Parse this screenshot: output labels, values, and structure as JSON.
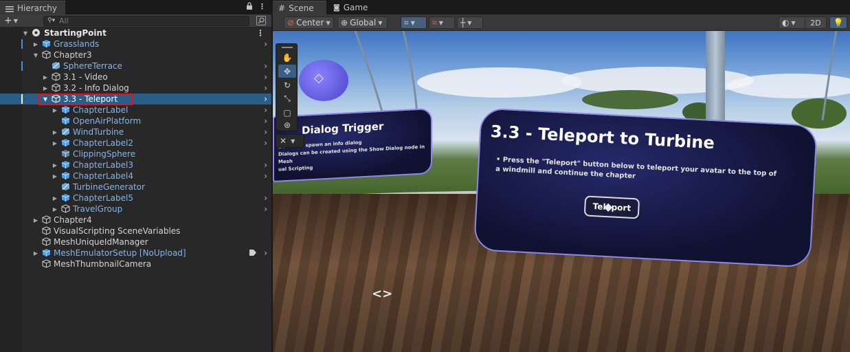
{
  "hierarchy": {
    "tab_label": "Hierarchy",
    "lock_icon": "lock-icon",
    "menu_icon": "vertical-ellipsis-icon",
    "add_label": "+",
    "search_placeholder": "All",
    "rows": [
      {
        "label": "StartingPoint",
        "kind": "root",
        "expanded": true
      },
      {
        "label": "Grasslands",
        "kind": "prefab",
        "expanded": false
      },
      {
        "label": "Chapter3",
        "kind": "plain",
        "expanded": true
      },
      {
        "label": "SphereTerrace",
        "kind": "prefab-variant"
      },
      {
        "label": "3.1 - Video",
        "kind": "plain",
        "expanded": false
      },
      {
        "label": "3.2 - Info Dialog",
        "kind": "plain",
        "expanded": false
      },
      {
        "label": "3.3 - Teleport",
        "kind": "plain",
        "expanded": true,
        "selected": true
      },
      {
        "label": "ChapterLabel",
        "kind": "prefab",
        "expanded": false
      },
      {
        "label": "OpenAirPlatform",
        "kind": "prefab"
      },
      {
        "label": "WindTurbine",
        "kind": "prefab-variant",
        "expanded": false
      },
      {
        "label": "ChapterLabel2",
        "kind": "prefab",
        "expanded": false
      },
      {
        "label": "ClippingSphere",
        "kind": "prefab"
      },
      {
        "label": "ChapterLabel3",
        "kind": "prefab",
        "expanded": false
      },
      {
        "label": "ChapterLabel4",
        "kind": "prefab",
        "expanded": false
      },
      {
        "label": "TurbineGenerator",
        "kind": "prefab"
      },
      {
        "label": "ChapterLabel5",
        "kind": "prefab",
        "expanded": false
      },
      {
        "label": "TravelGroup",
        "kind": "prefab",
        "expanded": false
      },
      {
        "label": "Chapter4",
        "kind": "plain",
        "expanded": false
      },
      {
        "label": "VisualScripting SceneVariables",
        "kind": "plain"
      },
      {
        "label": "MeshUniqueIdManager",
        "kind": "plain"
      },
      {
        "label": "MeshEmulatorSetup [NoUpload]",
        "kind": "prefab",
        "expanded": false
      },
      {
        "label": "MeshThumbnailCamera",
        "kind": "plain"
      }
    ]
  },
  "scene": {
    "tabs": [
      {
        "label": "Scene",
        "icon": "grid-icon"
      },
      {
        "label": "Game",
        "icon": "gamepad-icon"
      }
    ],
    "pivot_label": "Center",
    "space_label": "Global",
    "mode_2d_label": "2D",
    "left_panel_title": "Dialog Trigger",
    "left_panel_text": "button to spawn an info dialog\nDialogs can be created using the Show Dialog node in Mesh\nual Scripting",
    "right_panel_title": "3.3 - Teleport to Turbine",
    "right_panel_text": "• Press the \"Teleport\" button below to teleport your avatar to the top of a windmill and continue the chapter",
    "teleport_button_label": "Teleport",
    "tools": [
      "hand-tool-icon",
      "move-tool-icon",
      "rotate-tool-icon",
      "scale-tool-icon",
      "rect-tool-icon",
      "transform-tool-icon"
    ],
    "colors": {
      "selection": "#2c5d87",
      "prefab_text": "#7fb6f2",
      "highlight_box": "#e8121b",
      "panel_border": "#8c87e6"
    }
  }
}
